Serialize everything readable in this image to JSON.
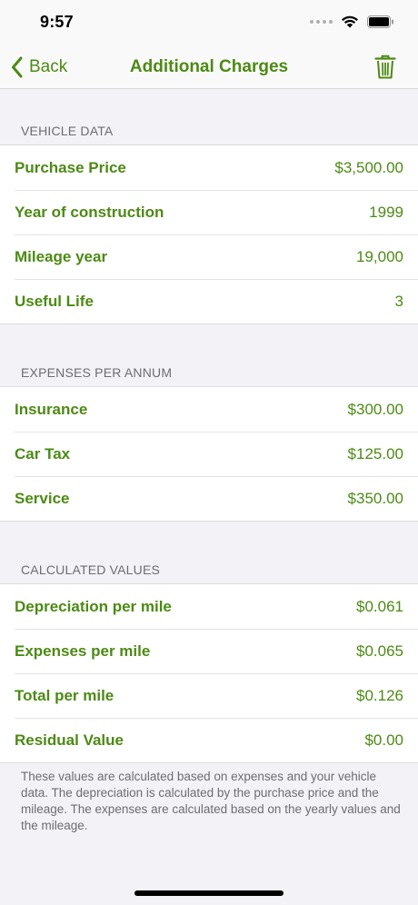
{
  "status": {
    "time": "9:57"
  },
  "nav": {
    "back_label": "Back",
    "title": "Additional Charges"
  },
  "sections": {
    "vehicle": {
      "header": "VEHICLE DATA",
      "rows": [
        {
          "label": "Purchase Price",
          "value": "$3,500.00"
        },
        {
          "label": "Year of construction",
          "value": "1999"
        },
        {
          "label": "Mileage year",
          "value": "19,000"
        },
        {
          "label": "Useful Life",
          "value": "3"
        }
      ]
    },
    "expenses": {
      "header": "EXPENSES PER ANNUM",
      "rows": [
        {
          "label": "Insurance",
          "value": "$300.00"
        },
        {
          "label": "Car Tax",
          "value": "$125.00"
        },
        {
          "label": "Service",
          "value": "$350.00"
        }
      ]
    },
    "calculated": {
      "header": "CALCULATED VALUES",
      "rows": [
        {
          "label": "Depreciation per mile",
          "value": "$0.061"
        },
        {
          "label": "Expenses per mile",
          "value": "$0.065"
        },
        {
          "label": "Total per mile",
          "value": "$0.126"
        },
        {
          "label": "Residual Value",
          "value": "$0.00"
        }
      ]
    }
  },
  "footer": "These values are calculated based on expenses and your vehicle data. The depreciation is calculated by the purchase price and the mileage. The expenses are calculated based on the yearly values and the mileage.",
  "colors": {
    "accent": "#4d8a14",
    "background": "#f2f2f7",
    "secondary_text": "#6d6d72"
  },
  "icons": {
    "back": "chevron-left-icon",
    "delete": "trash-icon",
    "cellular": "cellular-signal-icon",
    "wifi": "wifi-icon",
    "battery": "battery-icon"
  }
}
